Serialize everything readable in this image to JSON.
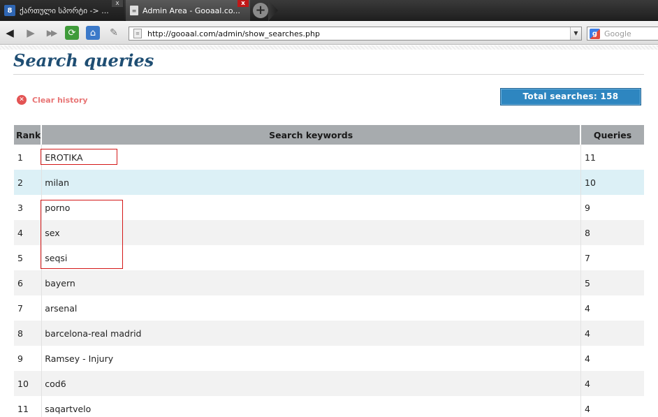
{
  "browser": {
    "tabs": [
      {
        "title": "ქართული სპორტი -> ...",
        "icon": "site-favicon",
        "icon_glyph": "8",
        "active": false
      },
      {
        "title": "Admin Area - Gooaal.co...",
        "icon": "page-icon",
        "icon_glyph": "≡",
        "active": true
      }
    ],
    "new_tab_glyph": "+",
    "url": "http://gooaal.com/admin/show_searches.php",
    "search_placeholder": "Google",
    "nav_glyphs": {
      "back": "◀",
      "forward": "▶",
      "fastforward": "▶▶",
      "reload": "⟳",
      "home": "⌂",
      "edit": "✎"
    },
    "close_glyph": "x"
  },
  "page": {
    "title": "Search queries",
    "clear_history_label": "Clear history",
    "total_searches_label": "Total searches: 158"
  },
  "table": {
    "columns": [
      "Rank",
      "Search keywords",
      "Queries"
    ],
    "rows": [
      {
        "rank": "1",
        "keyword": "EROTIKA",
        "queries": "11"
      },
      {
        "rank": "2",
        "keyword": "milan",
        "queries": "10"
      },
      {
        "rank": "3",
        "keyword": "porno",
        "queries": "9"
      },
      {
        "rank": "4",
        "keyword": "sex",
        "queries": "8"
      },
      {
        "rank": "5",
        "keyword": "seqsi",
        "queries": "7"
      },
      {
        "rank": "6",
        "keyword": "bayern",
        "queries": "5"
      },
      {
        "rank": "7",
        "keyword": "arsenal",
        "queries": "4"
      },
      {
        "rank": "8",
        "keyword": "barcelona-real madrid",
        "queries": "4"
      },
      {
        "rank": "9",
        "keyword": "Ramsey - Injury",
        "queries": "4"
      },
      {
        "rank": "10",
        "keyword": "cod6",
        "queries": "4"
      },
      {
        "rank": "11",
        "keyword": "saqartvelo",
        "queries": "4"
      }
    ]
  },
  "colors": {
    "title": "#1f4e73",
    "clear_history": "#e87575",
    "total_box": "#2e86c0",
    "header_bg": "#a7abae",
    "highlight_row": "#dcf0f6",
    "annotation": "#d41818"
  }
}
